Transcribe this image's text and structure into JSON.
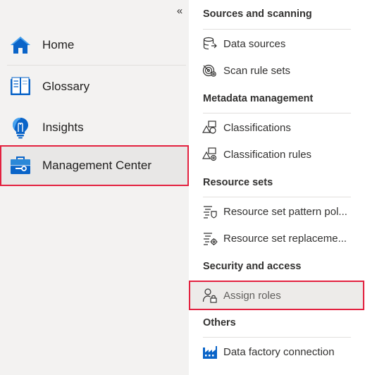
{
  "nav": {
    "collapse_glyph": "«",
    "items": [
      {
        "label": "Home",
        "icon": "home-icon"
      },
      {
        "label": "Glossary",
        "icon": "glossary-book-icon"
      },
      {
        "label": "Insights",
        "icon": "insights-lightbulb-icon"
      },
      {
        "label": "Management Center",
        "icon": "toolbox-icon",
        "active": true
      }
    ]
  },
  "flyout": {
    "sections": [
      {
        "heading": "Sources and scanning",
        "links": [
          {
            "label": "Data sources",
            "icon": "database-icon"
          },
          {
            "label": "Scan rule sets",
            "icon": "scan-rule-icon"
          }
        ]
      },
      {
        "heading": "Metadata management",
        "links": [
          {
            "label": "Classifications",
            "icon": "classification-icon"
          },
          {
            "label": "Classification rules",
            "icon": "classification-rule-icon"
          }
        ]
      },
      {
        "heading": "Resource sets",
        "links": [
          {
            "label": "Resource set pattern pol...",
            "icon": "resource-pattern-icon"
          },
          {
            "label": "Resource set replaceme...",
            "icon": "resource-replace-icon"
          }
        ]
      },
      {
        "heading": "Security and access",
        "links": [
          {
            "label": "Assign roles",
            "icon": "person-lock-icon",
            "selected": true
          }
        ]
      },
      {
        "heading": "Others",
        "links": [
          {
            "label": "Data factory connection",
            "icon": "factory-icon"
          }
        ]
      }
    ]
  },
  "colors": {
    "highlight_border": "#e3213f",
    "nav_background": "#f3f2f1",
    "icon_blue": "#0078d4"
  }
}
